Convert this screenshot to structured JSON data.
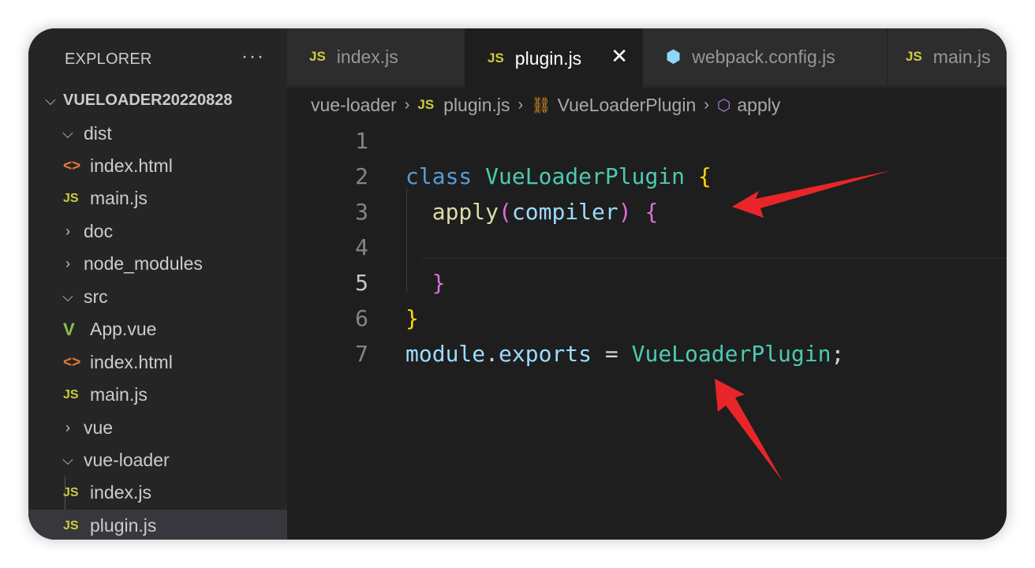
{
  "explorer": {
    "title": "EXPLORER",
    "more": "···",
    "root": "VUELOADER20220828",
    "items": [
      {
        "label": "dist",
        "kind": "folder-open"
      },
      {
        "label": "index.html",
        "kind": "html"
      },
      {
        "label": "main.js",
        "kind": "js"
      },
      {
        "label": "doc",
        "kind": "folder-closed"
      },
      {
        "label": "node_modules",
        "kind": "folder-closed"
      },
      {
        "label": "src",
        "kind": "folder-open"
      },
      {
        "label": "App.vue",
        "kind": "vue"
      },
      {
        "label": "index.html",
        "kind": "html"
      },
      {
        "label": "main.js",
        "kind": "js"
      },
      {
        "label": "vue",
        "kind": "folder-closed"
      },
      {
        "label": "vue-loader",
        "kind": "folder-open"
      },
      {
        "label": "index.js",
        "kind": "js"
      },
      {
        "label": "plugin.js",
        "kind": "js",
        "selected": true
      }
    ]
  },
  "tabs": [
    {
      "label": "index.js",
      "icon": "JS",
      "active": false
    },
    {
      "label": "plugin.js",
      "icon": "JS",
      "active": true,
      "close": "✕"
    },
    {
      "label": "webpack.config.js",
      "icon": "webpack-icon",
      "active": false
    },
    {
      "label": "main.js",
      "icon": "JS",
      "active": false
    }
  ],
  "breadcrumb": {
    "folder": "vue-loader",
    "file": "plugin.js",
    "class": "VueLoaderPlugin",
    "method": "apply"
  },
  "icons": {
    "js": "JS",
    "html": "<>",
    "vue": "V"
  },
  "code": {
    "line_numbers": [
      "1",
      "2",
      "3",
      "4",
      "5",
      "6",
      "7"
    ],
    "current_line": "5",
    "l2": {
      "kw": "class",
      "name": "VueLoaderPlugin",
      "brace": "{"
    },
    "l3": {
      "fn": "apply",
      "open": "(",
      "param": "compiler",
      "close": ")",
      "brace": "{"
    },
    "l5": {
      "brace": "}"
    },
    "l6": {
      "brace": "}"
    },
    "l7": {
      "obj": "module",
      "dot": ".",
      "prop": "exports",
      "eq": " = ",
      "val": "VueLoaderPlugin",
      "semi": ";"
    }
  },
  "colors": {
    "annotation_arrow": "#e8262a",
    "js_icon": "#cbcb41",
    "html_icon": "#e37933",
    "vue_icon": "#8dc149"
  }
}
